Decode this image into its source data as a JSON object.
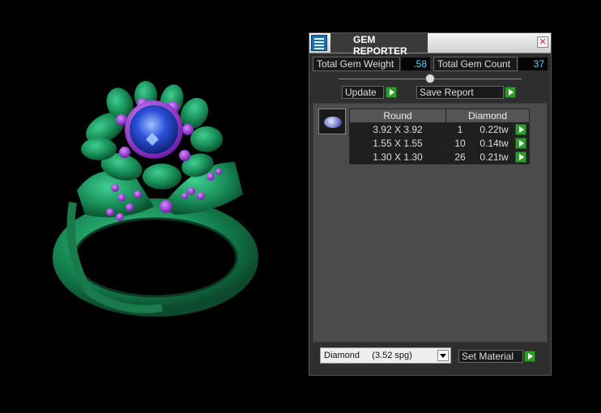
{
  "panel": {
    "title": "GEM REPORTER",
    "close_glyph": "✕",
    "total_weight_label": "Total Gem Weight",
    "total_weight_value": ".58",
    "total_count_label": "Total Gem Count",
    "total_count_value": "37",
    "update_label": "Update",
    "save_report_label": "Save Report",
    "table": {
      "headers": [
        "Round",
        "Diamond"
      ],
      "rows": [
        {
          "size": "3.92 X 3.92",
          "count": "1",
          "weight": "0.22tw"
        },
        {
          "size": "1.55 X 1.55",
          "count": "10",
          "weight": "0.14tw"
        },
        {
          "size": "1.30 X 1.30",
          "count": "26",
          "weight": "0.21tw"
        }
      ]
    },
    "material_select_value": "Diamond     (3.52 spg)",
    "set_material_label": "Set Material"
  },
  "colors": {
    "ring_metal": "#1e8a5a",
    "gem_center": "#2a4fd8",
    "accent_purple": "#9a22d8",
    "value_text": "#5fd0ff",
    "go_button": "#2e9d2e"
  },
  "icons": {
    "app": "gem-reporter-icon",
    "close": "close-icon",
    "go": "play-arrow-icon",
    "dropdown": "chevron-down-icon"
  }
}
